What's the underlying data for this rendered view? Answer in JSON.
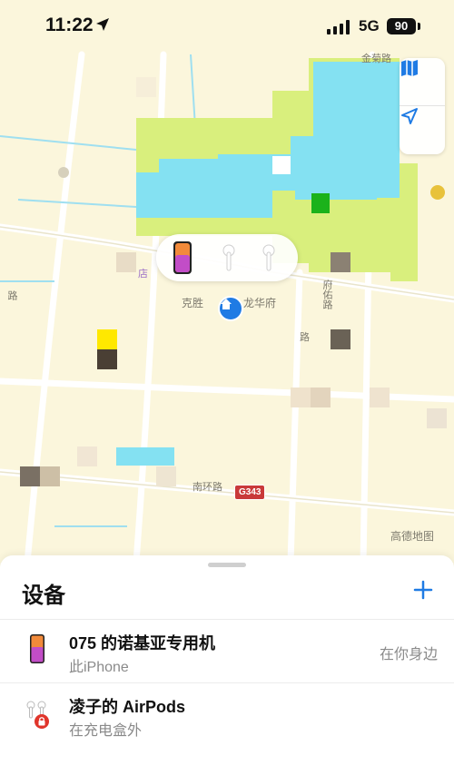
{
  "status_bar": {
    "time": "11:22",
    "network": "5G",
    "battery": "90"
  },
  "map": {
    "labels": {
      "road_top": "金菊路",
      "shop": "店",
      "poi": "克胜",
      "poi2": "龙华府",
      "road_right": "府佑路",
      "road_left_side": "路",
      "road_small": "路",
      "road_south": "南环路",
      "highway": "G343",
      "attribution": "高德地图"
    },
    "colors": {
      "water": "#84e1f2",
      "park": "#d9ef7d",
      "accent": "#1f7be4"
    }
  },
  "devices_panel": {
    "title": "设备",
    "add_icon": "plus-icon",
    "items": [
      {
        "name": "075 的诺基亚专用机",
        "subtitle": "此iPhone",
        "status": "在你身边",
        "icon": "iphone-icon"
      },
      {
        "name": "凌子的 AirPods",
        "subtitle": "在充电盒外",
        "status": "",
        "icon": "airpods-icon"
      }
    ]
  }
}
